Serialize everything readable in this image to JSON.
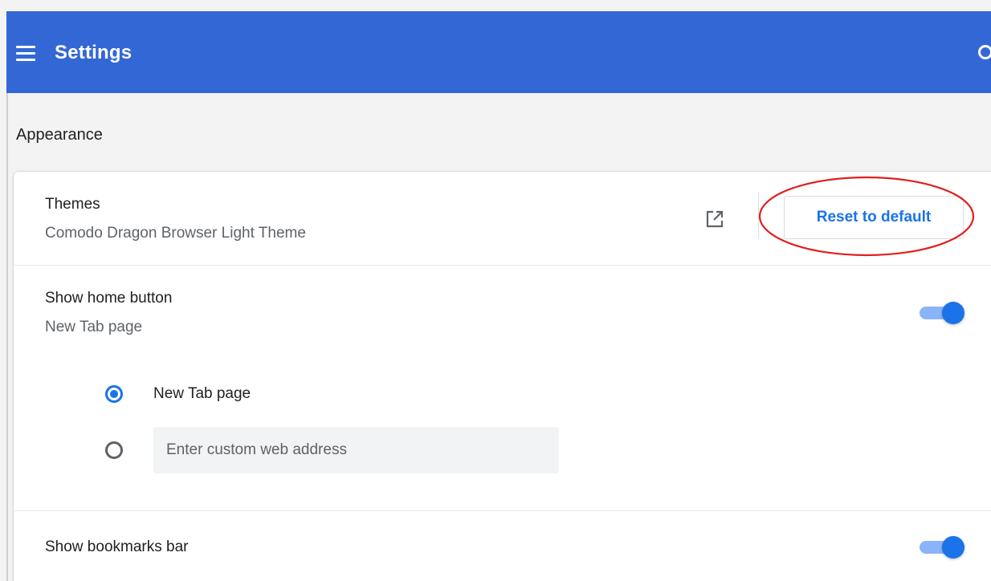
{
  "header": {
    "title": "Settings",
    "menu_icon": "hamburger-menu-icon",
    "search_icon": "search-icon",
    "color": "#3367d6"
  },
  "appearance": {
    "section_title": "Appearance",
    "themes": {
      "label": "Themes",
      "value": "Comodo Dragon Browser Light Theme",
      "open_icon": "external-link-icon",
      "reset_button": "Reset to default",
      "highlight_color": "#e02020"
    },
    "home_button": {
      "label": "Show home button",
      "value": "New Tab page",
      "enabled": true,
      "options": [
        {
          "label": "New Tab page",
          "selected": true
        },
        {
          "label": "",
          "placeholder": "Enter custom web address",
          "selected": false
        }
      ]
    },
    "bookmarks_bar": {
      "label": "Show bookmarks bar",
      "enabled": true
    }
  },
  "accent_color": "#1a73e8"
}
